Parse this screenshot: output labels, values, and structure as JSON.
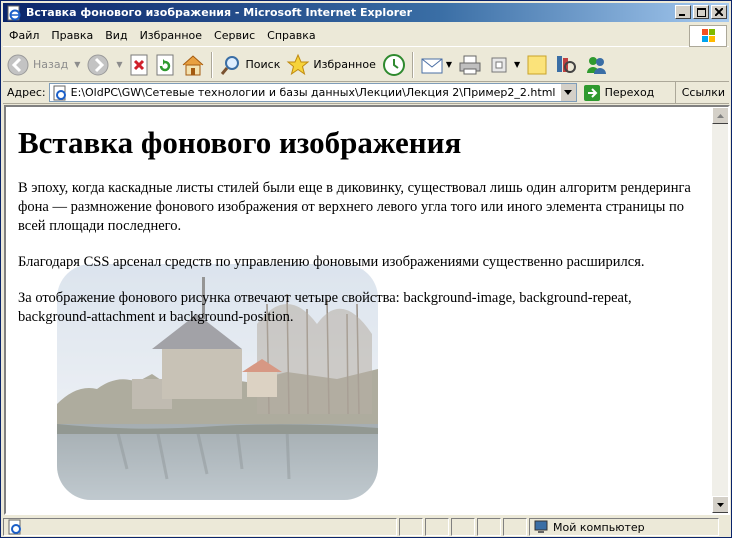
{
  "window": {
    "title": "Вставка фонового изображения - Microsoft Internet Explorer"
  },
  "menu": [
    "Файл",
    "Правка",
    "Вид",
    "Избранное",
    "Сервис",
    "Справка"
  ],
  "toolbar": {
    "back": "Назад",
    "search": "Поиск",
    "favorites": "Избранное"
  },
  "address": {
    "label": "Адрес:",
    "url": "E:\\OldPC\\GW\\Сетевые технологии и базы данных\\Лекции\\Лекция 2\\Пример2_2.html",
    "go": "Переход",
    "links": "Ссылки"
  },
  "page": {
    "heading": "Вставка фонового изображения",
    "p1": "В эпоху, когда каскадные листы стилей были еще в диковинку, существовал лишь один алгоритм рендеринга фона — размножение фонового изображения от верхнего левого угла того или иного элемента страницы по всей площади последнего.",
    "p2": "Благодаря CSS арсенал средств по управлению фоновыми изображениями существенно расширился.",
    "p3": "За отображение фонового рисунка отвечают четыре свойства: background-image, background-repeat, background-attachment и background-position."
  },
  "status": {
    "zone": "Мой компьютер"
  }
}
